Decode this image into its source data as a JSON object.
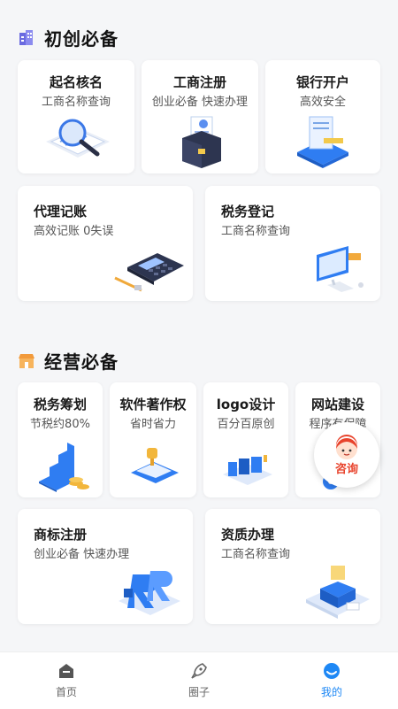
{
  "sections": {
    "startup": {
      "title": "初创必备",
      "cards": [
        {
          "title": "起名核名",
          "subtitle": "工商名称查询"
        },
        {
          "title": "工商注册",
          "subtitle": "创业必备 快速办理"
        },
        {
          "title": "银行开户",
          "subtitle": "高效安全"
        },
        {
          "title": "代理记账",
          "subtitle": "高效记账 0失误"
        },
        {
          "title": "税务登记",
          "subtitle": "工商名称查询"
        }
      ]
    },
    "business": {
      "title": "经营必备",
      "cards": [
        {
          "title": "税务筹划",
          "subtitle": "节税约80%"
        },
        {
          "title": "软件著作权",
          "subtitle": "省时省力"
        },
        {
          "title": "logo设计",
          "subtitle": "百分百原创"
        },
        {
          "title": "网站建设",
          "subtitle": "程序有保障"
        },
        {
          "title": "商标注册",
          "subtitle": "创业必备 快速办理"
        },
        {
          "title": "资质办理",
          "subtitle": "工商名称查询"
        }
      ]
    }
  },
  "consult": {
    "label": "咨询"
  },
  "tabbar": {
    "tabs": [
      {
        "label": "首页",
        "icon": "home-icon"
      },
      {
        "label": "圈子",
        "icon": "rocket-icon"
      },
      {
        "label": "我的",
        "icon": "profile-icon",
        "active": true
      }
    ]
  },
  "colors": {
    "accent": "#1e88f5",
    "consult": "#e8432c",
    "section1_icon": "#5b5bd6",
    "section2_icon": "#f29a3b"
  }
}
